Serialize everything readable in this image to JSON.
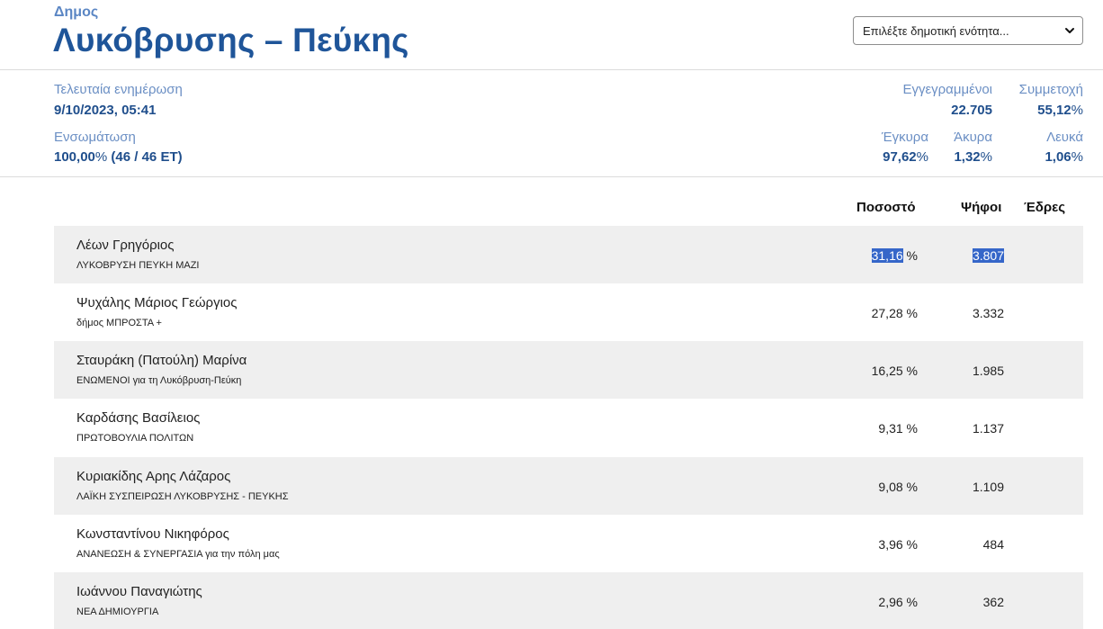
{
  "header": {
    "kicker": "Δημος",
    "title": "Λυκόβρυσης – Πεύκης",
    "select_value": "Επιλέξτε δημοτική ενότητα..."
  },
  "summary": {
    "last_update_label": "Τελευταία ενημέρωση",
    "last_update_value": "9/10/2023, 05:41",
    "integration_label": "Ενσωμάτωση",
    "integration_value": "100,00",
    "integration_pct_sign": "%",
    "integration_detail": "(46 / 46 ΕΤ)",
    "registered_label": "Εγγεγραμμένοι",
    "registered_value": "22.705",
    "turnout_label": "Συμμετοχή",
    "turnout_value": "55,12",
    "valid_label": "Έγκυρα",
    "valid_value": "97,62",
    "invalid_label": "Άκυρα",
    "invalid_value": "1,32",
    "blank_label": "Λευκά",
    "blank_value": "1,06",
    "pct_sign": "%"
  },
  "table": {
    "col_percent": "Ποσοστό",
    "col_votes": "Ψήφοι",
    "col_seats": "Έδρες",
    "pct_sign": "%",
    "rows": [
      {
        "name": "Λέων Γρηγόριος",
        "party": "ΛΥΚΟΒΡΥΣΗ ΠΕΥΚΗ ΜΑΖΙ",
        "percent": "31,16",
        "votes": "3.807"
      },
      {
        "name": "Ψυχάλης Μάριος Γεώργιος",
        "party": "δήμος ΜΠΡΟΣΤΑ +",
        "percent": "27,28",
        "votes": "3.332"
      },
      {
        "name": "Σταυράκη (Πατούλη) Μαρίνα",
        "party": "ΕΝΩΜΕΝΟΙ για τη Λυκόβρυση-Πεύκη",
        "percent": "16,25",
        "votes": "1.985"
      },
      {
        "name": "Καρδάσης Βασίλειος",
        "party": "ΠΡΩΤΟΒΟΥΛΙΑ ΠΟΛΙΤΩΝ",
        "percent": "9,31",
        "votes": "1.137"
      },
      {
        "name": "Κυριακίδης Αρης Λάζαρος",
        "party": "ΛΑΪΚΗ ΣΥΣΠΕΙΡΩΣΗ ΛΥΚΟΒΡΥΣΗΣ - ΠΕΥΚΗΣ",
        "percent": "9,08",
        "votes": "1.109"
      },
      {
        "name": "Κωνσταντίνου Νικηφόρος",
        "party": "ΑΝΑΝΕΩΣΗ & ΣΥΝΕΡΓΑΣΙΑ για την πόλη μας",
        "percent": "3,96",
        "votes": "484"
      },
      {
        "name": "Ιωάννου Παναγιώτης",
        "party": "ΝΕΑ ΔΗΜΙΟΥΡΓΙΑ",
        "percent": "2,96",
        "votes": "362"
      }
    ]
  }
}
